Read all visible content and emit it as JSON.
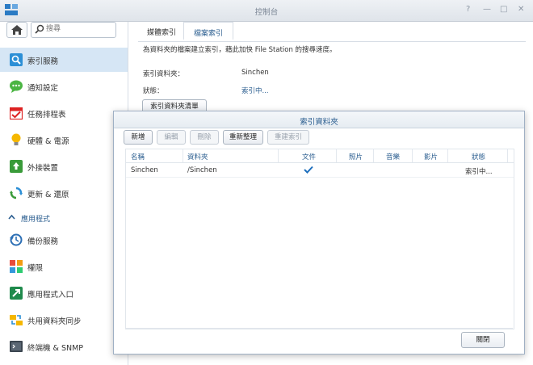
{
  "window": {
    "title": "控制台",
    "controls": [
      "?",
      "—",
      "□",
      "✕"
    ]
  },
  "search": {
    "placeholder": "搜尋"
  },
  "sidebar": {
    "items": [
      {
        "label": "索引服務",
        "icon": "index-service-icon",
        "active": true
      },
      {
        "label": "通知設定",
        "icon": "notification-icon"
      },
      {
        "label": "任務排程表",
        "icon": "task-scheduler-icon"
      },
      {
        "label": "硬體 & 電源",
        "icon": "hardware-power-icon"
      },
      {
        "label": "外接裝置",
        "icon": "external-devices-icon"
      },
      {
        "label": "更新 & 還原",
        "icon": "update-restore-icon"
      }
    ],
    "section": {
      "label": "應用程式"
    },
    "items2": [
      {
        "label": "備份服務",
        "icon": "backup-service-icon"
      },
      {
        "label": "權限",
        "icon": "privileges-icon"
      },
      {
        "label": "應用程式入口",
        "icon": "application-portal-icon"
      },
      {
        "label": "共用資料夾同步",
        "icon": "shared-folder-sync-icon"
      },
      {
        "label": "終端機 & SNMP",
        "icon": "terminal-snmp-icon"
      }
    ]
  },
  "main": {
    "tabs": [
      {
        "label": "媒體索引"
      },
      {
        "label": "檔案索引",
        "active": true
      }
    ],
    "description": "為資料夾的檔案建立索引，藉此加快 File Station 的搜尋速度。",
    "fields": [
      {
        "key": "索引資料夾：",
        "value": "Sinchen"
      },
      {
        "key": "狀態：",
        "value": "索引中..."
      }
    ],
    "list_button": "索引資料夾清單"
  },
  "dialog": {
    "title": "索引資料夾",
    "toolbar": {
      "add": "新增",
      "edit": "編輯",
      "delete": "刪除",
      "reorganize": "重新整理",
      "rebuild": "重建索引"
    },
    "columns": [
      "名稱",
      "資料夾",
      "文件",
      "照片",
      "音樂",
      "影片",
      "狀態"
    ],
    "rows": [
      {
        "name": "Sinchen",
        "folder": "/Sinchen",
        "document_checked": true,
        "photo": "",
        "music": "",
        "video": "",
        "status": "索引中..."
      }
    ],
    "close_button": "關閉"
  },
  "colors": {
    "accent": "#2a5d8f",
    "active_bg": "#d6e6f5",
    "check": "#1e6fbd"
  }
}
